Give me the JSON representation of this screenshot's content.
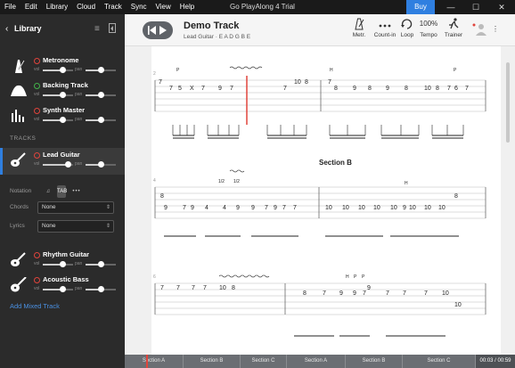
{
  "menu": {
    "items": [
      "File",
      "Edit",
      "Library",
      "Cloud",
      "Track",
      "Sync",
      "View",
      "Help"
    ],
    "window_title": "Go PlayAlong 4 Trial",
    "buy_label": "Buy"
  },
  "sidebar": {
    "library_label": "Library",
    "tracks_label": "TRACKS",
    "notation_label": "Notation",
    "chords_label": "Chords",
    "chords_value": "None",
    "lyrics_label": "Lyrics",
    "lyrics_value": "None",
    "add_mixed_label": "Add Mixed Track",
    "vol_label": "vol",
    "pan_label": "pan",
    "top_tracks": [
      {
        "name": "Metronome",
        "status": "red",
        "icon": "metronome-icon"
      },
      {
        "name": "Backing Track",
        "status": "green",
        "icon": "waveform-icon"
      },
      {
        "name": "Synth Master",
        "status": "red",
        "icon": "synth-bars-icon"
      }
    ],
    "tracks": [
      {
        "name": "Lead Guitar",
        "status": "red",
        "icon": "guitar-icon",
        "active": true
      },
      {
        "name": "Rhythm Guitar",
        "status": "red",
        "icon": "guitar-icon",
        "active": false
      },
      {
        "name": "Acoustic Bass",
        "status": "red",
        "icon": "bass-icon",
        "active": false
      }
    ]
  },
  "song": {
    "title": "Demo Track",
    "subtitle": "Lead Guitar · E A D G B E"
  },
  "toolbar": {
    "metronome_label": "Metr.",
    "countin_label": "Count-in",
    "loop_label": "Loop",
    "tempo_value": "100%",
    "tempo_label": "Tempo",
    "trainer_label": "Trainer"
  },
  "score": {
    "section_b_label": "Section B",
    "bars": [
      "2",
      "3",
      "4",
      "5",
      "6",
      "7"
    ]
  },
  "timeline": {
    "sections": [
      "Section A",
      "Section B",
      "Section C",
      "Section A",
      "Section B",
      "Section C"
    ],
    "time": "00:03 / 00:59"
  },
  "colors": {
    "accent": "#2f7fe0",
    "playhead": "#e0443c",
    "sidebar_bg": "#2b2b2b"
  }
}
